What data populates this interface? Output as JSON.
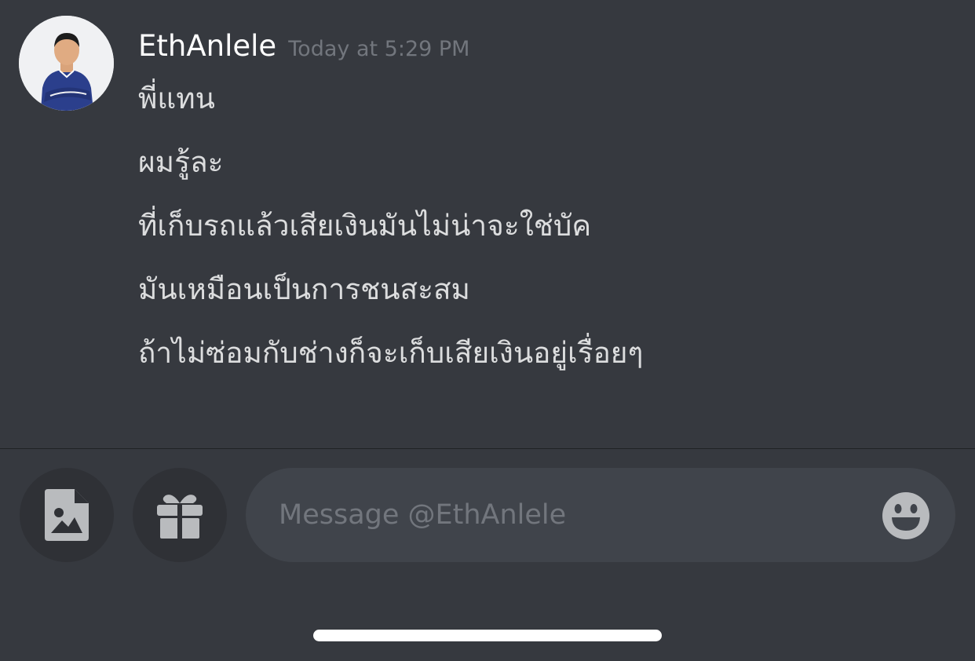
{
  "message": {
    "author": "EthAnlele",
    "timestamp": "Today at 5:29 PM",
    "lines": [
      "พี่แทน",
      "ผมรู้ละ",
      "ที่เก็บรถแล้วเสียเงินมันไม่น่าจะใช่บัค",
      "มันเหมือนเป็นการชนสะสม",
      "ถ้าไม่ซ่อมกับช่างก็จะเก็บเสียเงินอยู่เรื่อยๆ"
    ]
  },
  "composer": {
    "placeholder": "Message @EthAnlele",
    "value": ""
  },
  "icons": {
    "attach": "image-file-icon",
    "gift": "gift-icon",
    "emoji": "emoji-smile-icon"
  },
  "colors": {
    "background": "#36393f",
    "username": "#ffffff",
    "timestamp": "#72767d",
    "message_text": "#dcddde",
    "composer_bg": "#40444b",
    "button_bg": "#2f3136",
    "icon": "#b9bbbe"
  }
}
